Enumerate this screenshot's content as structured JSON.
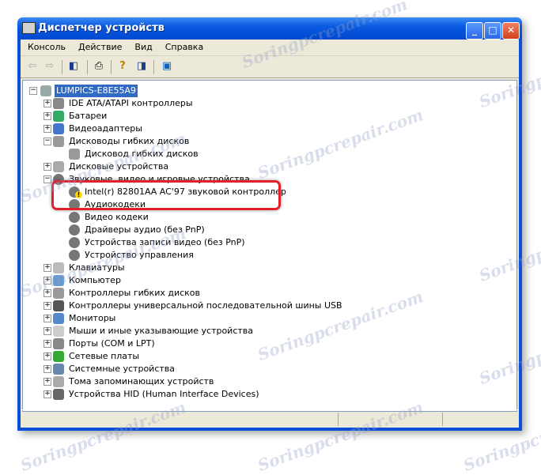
{
  "window": {
    "title": "Диспетчер устройств"
  },
  "menu": [
    "Консоль",
    "Действие",
    "Вид",
    "Справка"
  ],
  "toolbar": [
    "back",
    "forward",
    "show-hide-console-tree",
    "print",
    "help",
    "show-hide-action-pane",
    "update-driver"
  ],
  "tree": {
    "root": "LUMPICS-E8E55A9",
    "items": [
      {
        "label": "IDE ATA/ATAPI контроллеры",
        "level": 1,
        "exp": "+",
        "icon": "ide"
      },
      {
        "label": "Батареи",
        "level": 1,
        "exp": "+",
        "icon": "battery"
      },
      {
        "label": "Видеоадаптеры",
        "level": 1,
        "exp": "+",
        "icon": "display"
      },
      {
        "label": "Дисководы гибких дисков",
        "level": 1,
        "exp": "−",
        "icon": "floppy"
      },
      {
        "label": "Дисковод гибких дисков",
        "level": 2,
        "icon": "floppy"
      },
      {
        "label": "Дисковые устройства",
        "level": 1,
        "exp": "+",
        "icon": "disk"
      },
      {
        "label": "Звуковые, видео и игровые устройства",
        "level": 1,
        "exp": "−",
        "icon": "sound"
      },
      {
        "label": "Intel(r) 82801AA AC'97 звуковой контроллер",
        "level": 2,
        "icon": "sound",
        "warning": true
      },
      {
        "label": "Аудиокодеки",
        "level": 2,
        "icon": "sound"
      },
      {
        "label": "Видео кодеки",
        "level": 2,
        "icon": "sound"
      },
      {
        "label": "Драйверы аудио (без PnP)",
        "level": 2,
        "icon": "sound"
      },
      {
        "label": "Устройства записи видео (без PnP)",
        "level": 2,
        "icon": "sound"
      },
      {
        "label": "Устройство управления",
        "level": 2,
        "icon": "sound"
      },
      {
        "label": "Клавиатуры",
        "level": 1,
        "exp": "+",
        "icon": "keyboard"
      },
      {
        "label": "Компьютер",
        "level": 1,
        "exp": "+",
        "icon": "computer"
      },
      {
        "label": "Контроллеры гибких дисков",
        "level": 1,
        "exp": "+",
        "icon": "controller"
      },
      {
        "label": "Контроллеры универсальной последовательной шины USB",
        "level": 1,
        "exp": "+",
        "icon": "usb"
      },
      {
        "label": "Мониторы",
        "level": 1,
        "exp": "+",
        "icon": "monitor"
      },
      {
        "label": "Мыши и иные указывающие устройства",
        "level": 1,
        "exp": "+",
        "icon": "mouse"
      },
      {
        "label": "Порты (COM и LPT)",
        "level": 1,
        "exp": "+",
        "icon": "port"
      },
      {
        "label": "Сетевые платы",
        "level": 1,
        "exp": "+",
        "icon": "network"
      },
      {
        "label": "Системные устройства",
        "level": 1,
        "exp": "+",
        "icon": "system"
      },
      {
        "label": "Тома запоминающих устройств",
        "level": 1,
        "exp": "+",
        "icon": "volume"
      },
      {
        "label": "Устройства HID (Human Interface Devices)",
        "level": 1,
        "exp": "+",
        "icon": "hid"
      }
    ]
  },
  "watermark": "Soringpcrepair.com",
  "colors": {
    "highlight": "#e2202a",
    "selection": "#316ac5",
    "warning": "#ffd800"
  }
}
